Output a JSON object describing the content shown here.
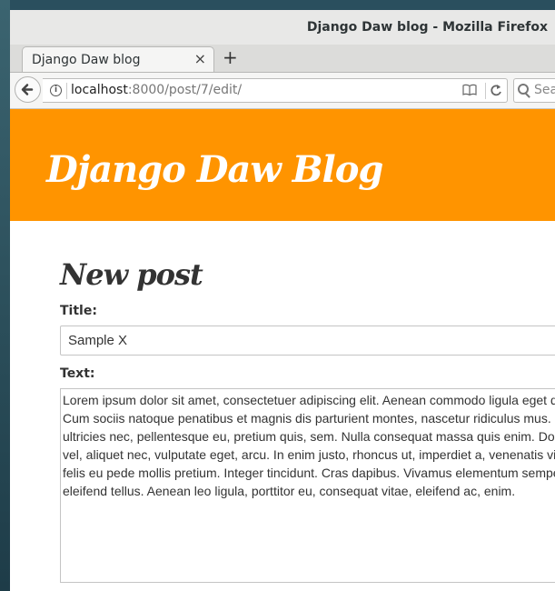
{
  "window": {
    "title": "Django Daw blog - Mozilla Firefox"
  },
  "tab": {
    "title": "Django Daw blog",
    "close_glyph": "×"
  },
  "new_tab_glyph": "+",
  "urlbar": {
    "host": "localhost",
    "rest": ":8000/post/7/edit/",
    "info_glyph": "i"
  },
  "searchbar": {
    "placeholder": "Sea"
  },
  "icons": {
    "back": "back-arrow-icon",
    "reload": "reload-icon",
    "reader": "reader-view-icon",
    "search": "search-icon"
  },
  "colors": {
    "header_bg": "#ff9400",
    "title_text": "#ffffff",
    "body_text": "#333333"
  },
  "header": {
    "site_title": "Django Daw Blog"
  },
  "form": {
    "heading": "New post",
    "title_label": "Title:",
    "title_value": "Sample X",
    "text_label": "Text:",
    "text_value": "Lorem ipsum dolor sit amet, consectetuer adipiscing elit. Aenean commodo ligula eget dolor. Aenean massa.\nCum sociis natoque penatibus et magnis dis parturient montes, nascetur ridiculus mus. Donec quam felis,\nultricies nec, pellentesque eu, pretium quis, sem. Nulla consequat massa quis enim. Donec pede justo, fringilla\nvel, aliquet nec, vulputate eget, arcu. In enim justo, rhoncus ut, imperdiet a, venenatis vitae, justo. Nullam dictum\nfelis eu pede mollis pretium. Integer tincidunt. Cras dapibus. Vivamus elementum semper nisi. Aenean vulputate\neleifend tellus. Aenean leo ligula, porttitor eu, consequat vitae, eleifend ac, enim."
  }
}
